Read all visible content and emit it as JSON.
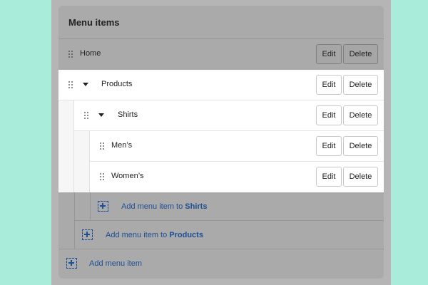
{
  "card": {
    "title": "Menu items"
  },
  "items": [
    {
      "label": "Home",
      "edit_label": "Edit",
      "delete_label": "Delete"
    },
    {
      "label": "Products",
      "edit_label": "Edit",
      "delete_label": "Delete"
    },
    {
      "label": "Shirts",
      "edit_label": "Edit",
      "delete_label": "Delete"
    },
    {
      "label": "Men’s",
      "edit_label": "Edit",
      "delete_label": "Delete"
    },
    {
      "label": "Women’s",
      "edit_label": "Edit",
      "delete_label": "Delete"
    }
  ],
  "add_links": {
    "shirts": {
      "prefix": "Add menu item to ",
      "target": "Shirts"
    },
    "products": {
      "prefix": "Add menu item to ",
      "target": "Products"
    },
    "root": {
      "label": "Add menu item"
    }
  },
  "colors": {
    "page_background": "#a8ecd9",
    "overlay": "#aaaaaa",
    "link": "#1d4e96",
    "highlight_row": "#ffffff"
  },
  "icons": {
    "drag": "drag-handle-icon",
    "collapse": "caret-down-icon",
    "add": "add-dashed-plus-icon"
  }
}
